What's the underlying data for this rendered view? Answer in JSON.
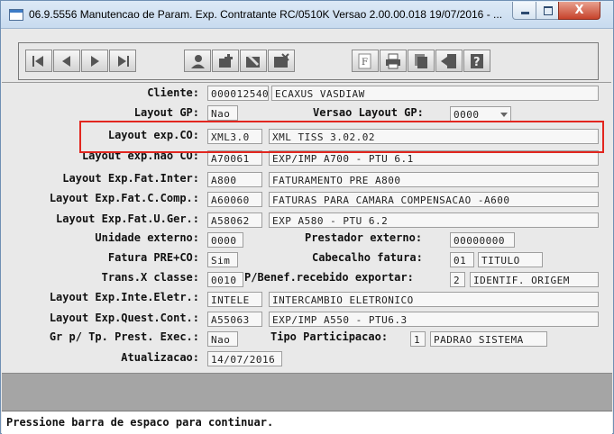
{
  "window": {
    "title": "06.9.5556 Manutencao  de Param. Exp. Contratante RC/0510K Versao 2.00.00.018 19/07/2016 - ...",
    "close_label": "X"
  },
  "toolbar": {
    "buttons": [
      "first-record",
      "previous-record",
      "next-record",
      "last-record",
      "user",
      "insert",
      "edit",
      "delete",
      "function",
      "print",
      "copy",
      "exit",
      "help"
    ]
  },
  "form": {
    "cliente": {
      "label": "Cliente:",
      "code": "000012540",
      "name": "ECAXUS VASDIAW"
    },
    "layout_gp": {
      "label": "Layout GP:",
      "value": "Nao"
    },
    "versao_layout_gp": {
      "label": "Versao Layout GP:",
      "value": "0000"
    },
    "layout_exp_co": {
      "label": "Layout exp.CO:",
      "code": "XML3.0",
      "desc": "XML TISS 3.02.02"
    },
    "layout_exp_nao_co": {
      "label": "Layout exp.nao CO:",
      "code": "A70061",
      "desc": "EXP/IMP A700 - PTU 6.1"
    },
    "layout_exp_fat_inter": {
      "label": "Layout Exp.Fat.Inter:",
      "code": "A800",
      "desc": "FATURAMENTO PRE A800"
    },
    "layout_exp_fat_c_comp": {
      "label": "Layout Exp.Fat.C.Comp.:",
      "code": "A60060",
      "desc": "FATURAS PARA CAMARA COMPENSACAO -A600"
    },
    "layout_exp_fat_u_ger": {
      "label": "Layout Exp.Fat.U.Ger.:",
      "code": "A58062",
      "desc": "EXP A580 - PTU 6.2"
    },
    "unidade_externo": {
      "label": "Unidade externo:",
      "value": "0000"
    },
    "prestador_externo": {
      "label": "Prestador externo:",
      "value": "00000000"
    },
    "fatura_pre_co": {
      "label": "Fatura PRE+CO:",
      "value": "Sim"
    },
    "cabecalho_fatura": {
      "label": "Cabecalho fatura:",
      "code": "01",
      "desc": "TITULO"
    },
    "trans_x_classe": {
      "label": "Trans.X classe:",
      "value": "0010"
    },
    "benef_recebido": {
      "label": "P/Benef.recebido exportar:",
      "code": "2",
      "desc": "IDENTIF. ORIGEM"
    },
    "layout_exp_inte_eletr": {
      "label": "Layout Exp.Inte.Eletr.:",
      "code": "INTELE",
      "desc": "INTERCAMBIO ELETRONICO"
    },
    "layout_exp_quest_cont": {
      "label": "Layout Exp.Quest.Cont.:",
      "code": "A55063",
      "desc": "EXP/IMP A550 - PTU6.3"
    },
    "gr_tp_prest_exec": {
      "label": "Gr p/ Tp. Prest. Exec.:",
      "value": "Nao"
    },
    "tipo_participacao": {
      "label": "Tipo Participacao:",
      "code": "1",
      "desc": "PADRAO SISTEMA"
    },
    "atualizacao": {
      "label": "Atualizacao:",
      "value": "14/07/2016"
    }
  },
  "status": {
    "message": "Pressione barra de espaco para continuar."
  },
  "colors": {
    "highlight": "#e2261f",
    "grey_bar": "#a5a5a5"
  }
}
